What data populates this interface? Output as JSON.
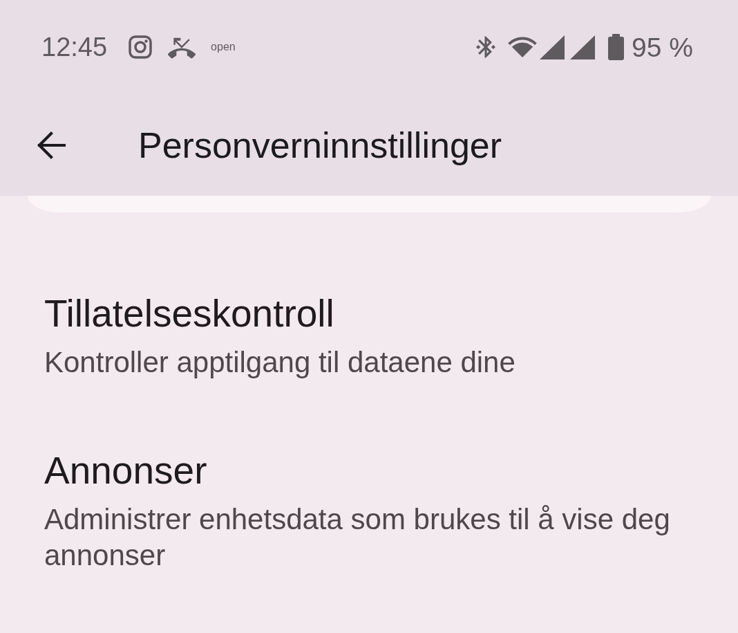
{
  "status_bar": {
    "time": "12:45",
    "notification_text": "open",
    "battery_text": "95 %"
  },
  "app_bar": {
    "title": "Personverninnstillinger"
  },
  "settings": [
    {
      "title": "Tillatelseskontroll",
      "summary": "Kontroller apptilgang til dataene dine"
    },
    {
      "title": "Annonser",
      "summary": "Administrer enhetsdata som brukes til å vise deg annonser"
    }
  ]
}
